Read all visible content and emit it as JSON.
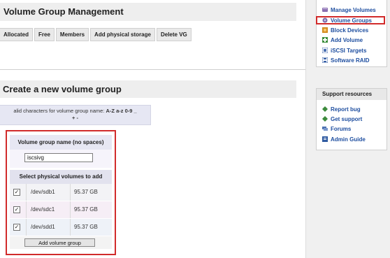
{
  "vg_management": {
    "title": "Volume Group Management",
    "columns": [
      "Allocated",
      "Free",
      "Members",
      "Add physical storage",
      "Delete VG"
    ]
  },
  "create_vg": {
    "title": "Create a new volume group",
    "valid_chars_prefix": "alid characters for volume group name:",
    "valid_chars_values": "A-Z a-z 0-9 _",
    "valid_chars_line2": "+ -",
    "name_label": "Volume group name (no spaces)",
    "name_value": "iscsivg",
    "select_label": "Select physical volumes to add",
    "volumes": [
      {
        "device": "/dev/sdb1",
        "size": "95.37 GB",
        "checked": "✓"
      },
      {
        "device": "/dev/sdc1",
        "size": "95.37 GB",
        "checked": "✓"
      },
      {
        "device": "/dev/sdd1",
        "size": "95.37 GB",
        "checked": "✓"
      }
    ],
    "submit_label": "Add volume group"
  },
  "sidebar": {
    "menu": [
      {
        "label": "Manage Volumes",
        "icon": "volumes-icon"
      },
      {
        "label": "Volume Groups",
        "icon": "volume-groups-icon"
      },
      {
        "label": "Block Devices",
        "icon": "block-devices-icon"
      },
      {
        "label": "Add Volume",
        "icon": "add-volume-icon"
      },
      {
        "label": "iSCSI Targets",
        "icon": "iscsi-targets-icon"
      },
      {
        "label": "Software RAID",
        "icon": "raid-icon"
      }
    ],
    "support": {
      "title": "Support resources",
      "items": [
        {
          "label": "Report bug",
          "icon": "bug-icon"
        },
        {
          "label": "Get support",
          "icon": "support-icon"
        },
        {
          "label": "Forums",
          "icon": "forums-icon"
        },
        {
          "label": "Admin Guide",
          "icon": "guide-icon"
        }
      ]
    }
  },
  "colors": {
    "highlight": "#d12b2b",
    "link": "#1f4fa0"
  }
}
